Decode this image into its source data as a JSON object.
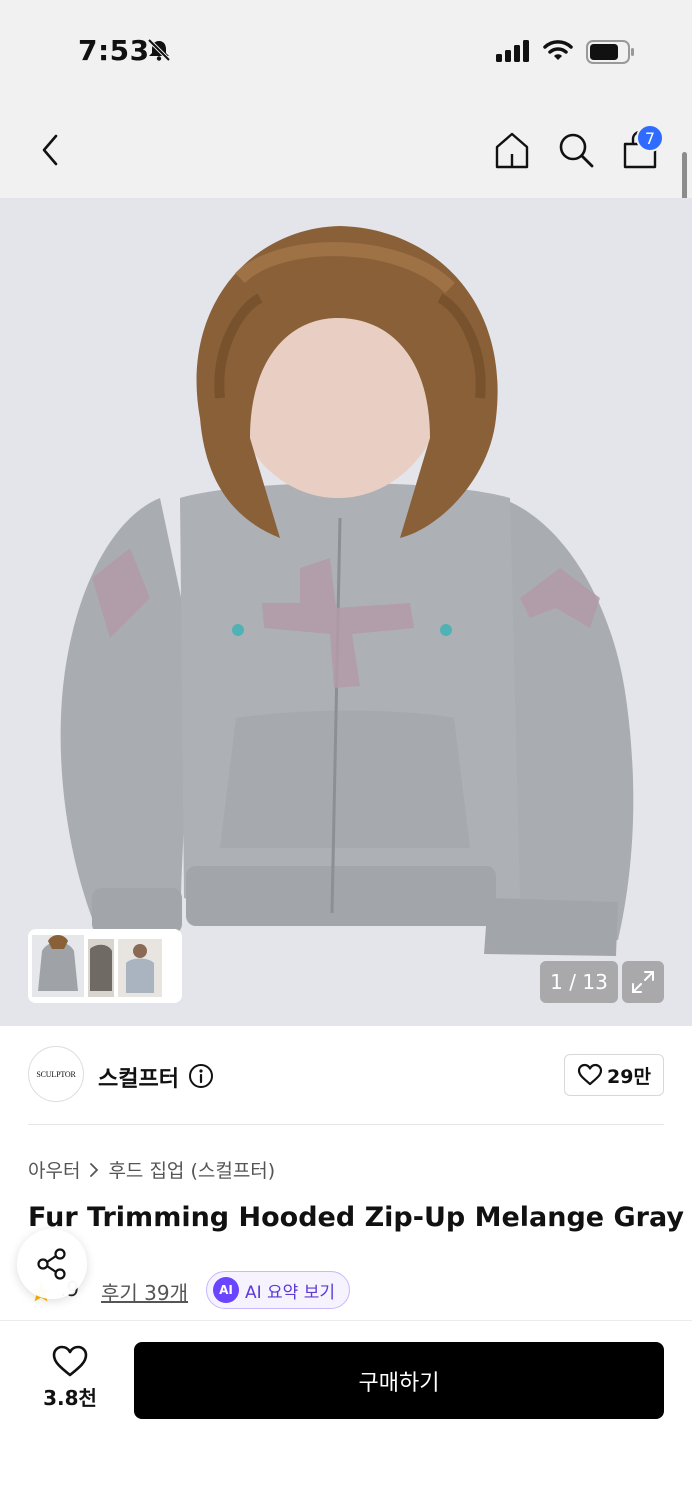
{
  "status": {
    "time": "7:53"
  },
  "nav": {
    "cart_count": "7"
  },
  "gallery": {
    "counter": "1 / 13"
  },
  "brand": {
    "logo_text": "SCULPTOR",
    "name": "스컬프터",
    "like_count": "29만"
  },
  "breadcrumb": {
    "category": "아우터",
    "subcategory": "후드 집업 (스컬프터)"
  },
  "product": {
    "title": "Fur Trimming Hooded Zip-Up Melange Gray"
  },
  "rating": {
    "value": ".9",
    "reviews": "후기 39개"
  },
  "ai_summary": {
    "badge": "AI",
    "label": "AI 요약 보기"
  },
  "bottom": {
    "wish_count": "3.8천",
    "buy_label": "구매하기"
  },
  "colors": {
    "accent_blue": "#2f6bff",
    "ai_purple": "#6a44ff",
    "buy_bg": "#000000"
  }
}
